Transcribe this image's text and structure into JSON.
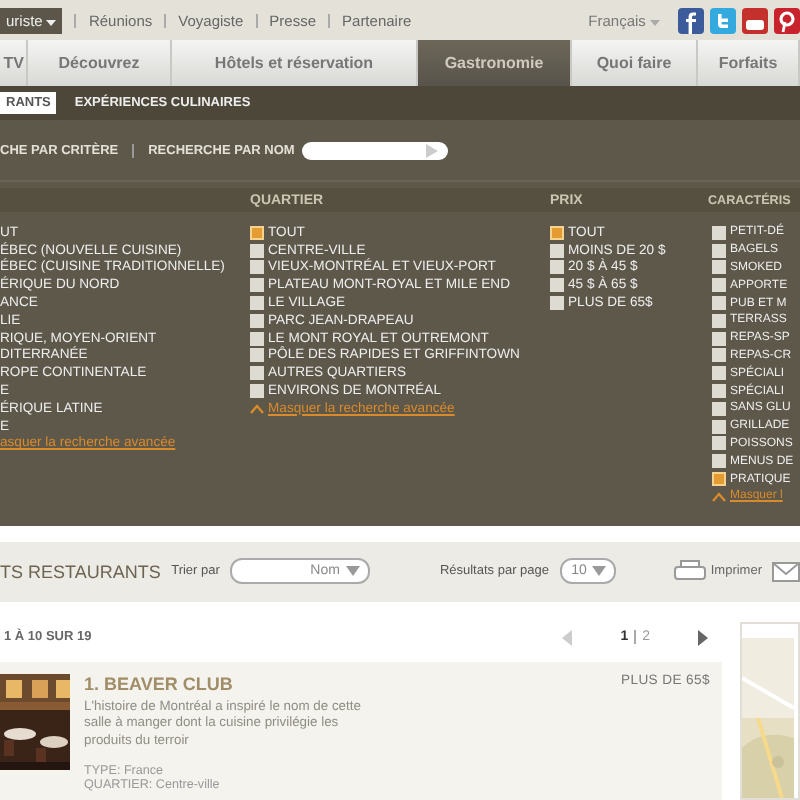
{
  "top_bar": {
    "account_menu": "uriste",
    "links": [
      "Réunions",
      "Voyagiste",
      "Presse",
      "Partenaire"
    ],
    "language": "Français"
  },
  "nav": {
    "tabs": [
      {
        "label": "TV",
        "selected": false
      },
      {
        "label": "Découvrez",
        "selected": false
      },
      {
        "label": "Hôtels et réservation",
        "selected": false
      },
      {
        "label": "Gastronomie",
        "selected": true
      },
      {
        "label": "Quoi faire",
        "selected": false
      },
      {
        "label": "Forfaits",
        "selected": false
      }
    ]
  },
  "subnav": {
    "tabs": [
      {
        "label": "RANTS",
        "selected": true
      },
      {
        "label": "EXPÉRIENCES CULINAIRES",
        "selected": false
      }
    ]
  },
  "search": {
    "criteria_label": "CHE PAR CRITÈRE",
    "name_label": "RECHERCHE PAR NOM"
  },
  "filters": [
    {
      "items": [
        {
          "label": "UT"
        },
        {
          "label": "ÉBEC (NOUVELLE CUISINE)"
        },
        {
          "label": "ÉBEC (CUISINE TRADITIONNELLE)"
        },
        {
          "label": "ÉRIQUE DU NORD"
        },
        {
          "label": "ANCE"
        },
        {
          "label": "LIE"
        },
        {
          "label": "RIQUE, MOYEN-ORIENT"
        },
        {
          "label": "DITERRANÉE"
        },
        {
          "label": "ROPE CONTINENTALE"
        },
        {
          "label": "E"
        },
        {
          "label": "ÉRIQUE LATINE"
        },
        {
          "label": "E"
        }
      ],
      "link": "asquer la recherche avancée",
      "show_boxes": false
    },
    {
      "heading": "QUARTIER",
      "items": [
        {
          "label": "TOUT",
          "checked": true
        },
        {
          "label": "CENTRE-VILLE",
          "checked": false
        },
        {
          "label": "VIEUX-MONTRÉAL ET VIEUX-PORT",
          "checked": false
        },
        {
          "label": "PLATEAU MONT-ROYAL ET MILE END",
          "checked": false
        },
        {
          "label": "LE VILLAGE",
          "checked": false
        },
        {
          "label": "PARC JEAN-DRAPEAU",
          "checked": false
        },
        {
          "label": "LE MONT ROYAL ET OUTREMONT",
          "checked": false
        },
        {
          "label": "PÔLE DES RAPIDES ET GRIFFINTOWN",
          "checked": false
        },
        {
          "label": "AUTRES QUARTIERS",
          "checked": false
        },
        {
          "label": "ENVIRONS DE MONTRÉAL",
          "checked": false
        }
      ],
      "link": "Masquer la recherche avancée",
      "show_boxes": true
    },
    {
      "heading": "PRIX",
      "items": [
        {
          "label": "TOUT",
          "checked": true
        },
        {
          "label": "MOINS DE 20 $",
          "checked": false
        },
        {
          "label": "20 $ À 45 $",
          "checked": false
        },
        {
          "label": "45 $ À 65 $",
          "checked": false
        },
        {
          "label": "PLUS DE 65$",
          "checked": false
        }
      ],
      "show_boxes": true
    },
    {
      "heading": "CARACTÉRIS",
      "items": [
        {
          "label": "PETIT-DÉ",
          "checked": false
        },
        {
          "label": "BAGELS",
          "checked": false
        },
        {
          "label": "SMOKED",
          "checked": false
        },
        {
          "label": "APPORTE",
          "checked": false
        },
        {
          "label": "PUB ET M",
          "checked": false
        },
        {
          "label": "TERRASS",
          "checked": false
        },
        {
          "label": "REPAS-SP",
          "checked": false
        },
        {
          "label": "REPAS-CR",
          "checked": false
        },
        {
          "label": "SPÉCIALI",
          "checked": false
        },
        {
          "label": "SPÉCIALI",
          "checked": false
        },
        {
          "label": "SANS GLU",
          "checked": false
        },
        {
          "label": "GRILLADE",
          "checked": false
        },
        {
          "label": "POISSONS",
          "checked": false
        },
        {
          "label": "MENUS DE",
          "checked": false
        },
        {
          "label": "PRATIQUE",
          "checked": true
        }
      ],
      "link": "Masquer l",
      "show_boxes": true
    }
  ],
  "toolbar": {
    "title": "TS RESTAURANTS",
    "sort_label": "Trier par",
    "sort_value": "Nom",
    "per_page_label": "Résultats par page",
    "per_page_value": "10",
    "print": "Imprimer"
  },
  "results": {
    "range": "1 À 10 SUR 19",
    "pages": [
      {
        "label": "1",
        "selected": true
      },
      {
        "label": "2",
        "selected": false
      }
    ]
  },
  "listing": {
    "title": "1. BEAVER CLUB",
    "description": "L'histoire de Montréal a inspiré le nom de cette salle à manger dont la cuisine privilégie les produits du terroir",
    "type": "TYPE: France",
    "quartier": "QUARTIER: Centre-ville",
    "price": "PLUS DE 65$"
  }
}
